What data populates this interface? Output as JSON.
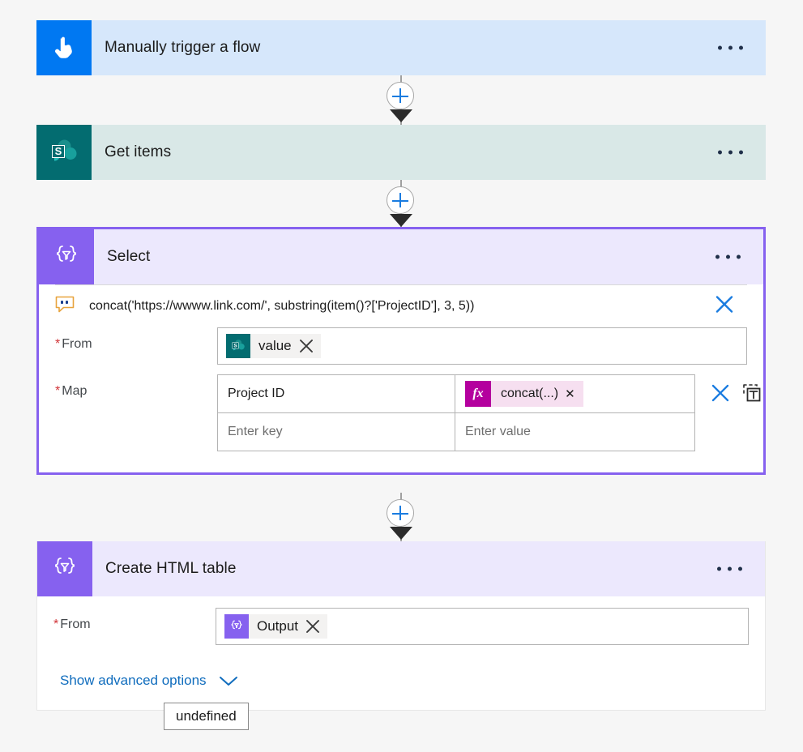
{
  "colors": {
    "page_background": "#f6f6f6",
    "trigger_card": "#d6e7fb",
    "trigger_icon": "#0078f2",
    "sharepoint_icon": "#036c70",
    "sharepoint_card": "#d9e8e7",
    "select_icon": "#8661ef",
    "select_card_header": "#ece8fd",
    "selected_border": "#8661ef",
    "expression_accent": "#b4009e",
    "link_blue": "#0f6cbd",
    "plus_blue": "#1a7ce0",
    "required_red": "#d13438"
  },
  "steps": [
    {
      "id": "manually-trigger-a-flow",
      "title": "Manually trigger a flow",
      "icon": "hand-pointer-icon",
      "menu": "more-commands"
    },
    {
      "id": "get-items",
      "title": "Get items",
      "icon": "sharepoint-icon",
      "menu": "more-commands"
    },
    {
      "id": "select",
      "title": "Select",
      "icon": "select-braces-icon",
      "menu": "more-commands",
      "expression_bar": {
        "icon": "expression-tooltip-icon",
        "text": "concat('https://wwww.link.com/', substring(item()?['ProjectID'], 3, 5))",
        "close_icon": "close-icon"
      },
      "fields": {
        "from": {
          "label": "From",
          "required": true,
          "token": {
            "icon": "sharepoint-icon",
            "label": "value",
            "remove_icon": "close-icon"
          }
        },
        "map": {
          "label": "Map",
          "required": true,
          "rows": [
            {
              "key": "Project ID",
              "value_token": {
                "icon": "fx-icon",
                "glyph": "fx",
                "label": "concat(...)",
                "remove_icon": "close-icon"
              }
            },
            {
              "key_placeholder": "Enter key",
              "value_placeholder": "Enter value"
            }
          ],
          "actions": [
            {
              "name": "delete-map-row",
              "icon": "close-icon"
            },
            {
              "name": "insert-dynamic-content",
              "icon": "paste-insert-icon"
            }
          ]
        }
      }
    },
    {
      "id": "create-html-table",
      "title": "Create HTML table",
      "icon": "select-braces-icon",
      "menu": "more-commands",
      "fields": {
        "from": {
          "label": "From",
          "required": true,
          "token": {
            "icon": "select-braces-icon",
            "label": "Output",
            "remove_icon": "close-icon"
          }
        }
      },
      "advanced_options": {
        "label": "Show advanced options",
        "chevron": "chevron-down-icon"
      }
    }
  ],
  "connectors": [
    {
      "name": "insert-step-between-trigger-and-getitems",
      "icon": "plus-icon"
    },
    {
      "name": "insert-step-between-getitems-and-select",
      "icon": "plus-icon"
    },
    {
      "name": "insert-step-between-select-and-htmltable",
      "icon": "plus-icon"
    }
  ],
  "tooltip": {
    "text": "undefined"
  }
}
